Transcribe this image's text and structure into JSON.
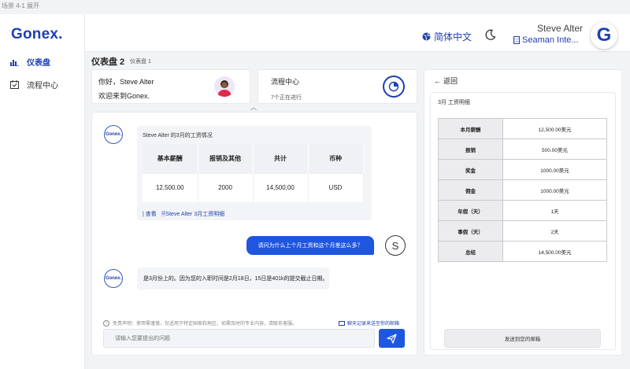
{
  "scene_label": "场景 4-1 展开",
  "brand": {
    "logo": "Gonex.",
    "accent": "#1e3fb0",
    "button_blue": "#1f56e0"
  },
  "sidebar": {
    "items": [
      {
        "label": "仪表盘",
        "icon": "bar-chart-icon",
        "active": true
      },
      {
        "label": "流程中心",
        "icon": "calendar-check-icon",
        "active": false
      }
    ]
  },
  "header": {
    "language": "简体中文",
    "theme_icon": "moon-icon",
    "user_name": "Steve Alter",
    "company": "Seaman Inte...",
    "avatar_letter": "G"
  },
  "page": {
    "title": "仪表盘 2",
    "subtitle": "仪表盘 1"
  },
  "welcome_card": {
    "greeting": "你好，Steve Alter",
    "message": "欢迎来到Gonex."
  },
  "flow_card": {
    "title": "流程中心",
    "status": "7个正在进行"
  },
  "chat": {
    "bot_label": "Gonex.",
    "salary_caption": "Steve Alter 的3月的工资情况",
    "salary_headers": [
      "基本薪酬",
      "报销及其他",
      "共计",
      "币种"
    ],
    "salary_values": [
      "12,500.00",
      "2000",
      "14,500,00",
      "USD"
    ],
    "links": [
      "| 查看",
      "Steve Alter 3月工资明细"
    ],
    "user_question": "请问为什么上个月工资和这个月差这么多？",
    "user_avatar": "S",
    "bot_reply": "是3月份上的。因为您的入职时间是2月18日，15日是401k的提交截止日期。",
    "disclaimer": "免责声明：使用需谨慎，仅适用于特定国家和地区，如需及时的专业内容，请联系客服。",
    "email_log": "聊天记录来送至你的邮箱",
    "input_placeholder": "请输入您要提出的问题"
  },
  "detail_panel": {
    "back_label": "返回",
    "title": "3月 工资明细",
    "rows": [
      {
        "key": "本月薪酬",
        "value": "12,500.00美元"
      },
      {
        "key": "报销",
        "value": "500.00美元"
      },
      {
        "key": "奖金",
        "value": "1000.00美元"
      },
      {
        "key": "佣金",
        "value": "1000.00美元"
      },
      {
        "key": "年假（天）",
        "value": "1天"
      },
      {
        "key": "事假（天）",
        "value": "2天"
      },
      {
        "key": "总结",
        "value": "14,500.00美元"
      }
    ],
    "send_button": "发送到您的邮箱"
  }
}
